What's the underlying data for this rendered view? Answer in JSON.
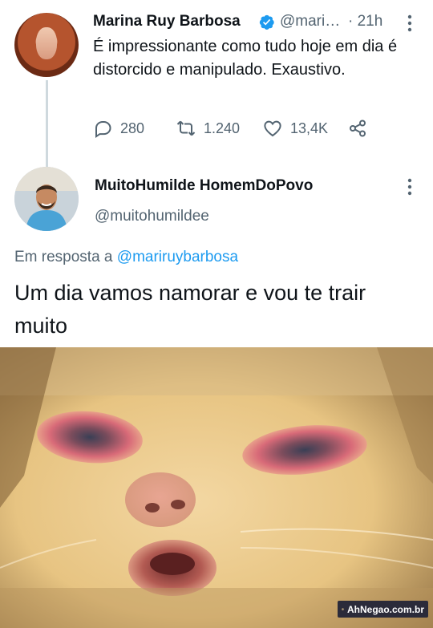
{
  "original_tweet": {
    "author_name": "Marina Ruy Barbosa",
    "handle": "@mari…",
    "time": "· 21h",
    "text": "É impressionante como tudo hoje em dia é distorcido e manipulado. Exaustivo.",
    "replies": "280",
    "retweets": "1.240",
    "likes": "13,4K"
  },
  "reply_tweet": {
    "author_name": "MuitoHumilde HomemDoPovo",
    "handle": "@muitohumildee",
    "in_reply_prefix": "Em resposta a ",
    "in_reply_handle": "@mariruybarbosa",
    "text": "Um dia vamos namorar e vou te trair muito"
  },
  "watermark": {
    "text": "AhNegao.com.br"
  },
  "colors": {
    "text": "#0f1419",
    "secondary": "#536471",
    "link": "#1d9bf0",
    "verified": "#1d9bf0"
  },
  "icons": [
    "verified-badge-icon",
    "more-icon",
    "reply-icon",
    "retweet-icon",
    "like-icon",
    "share-icon"
  ]
}
